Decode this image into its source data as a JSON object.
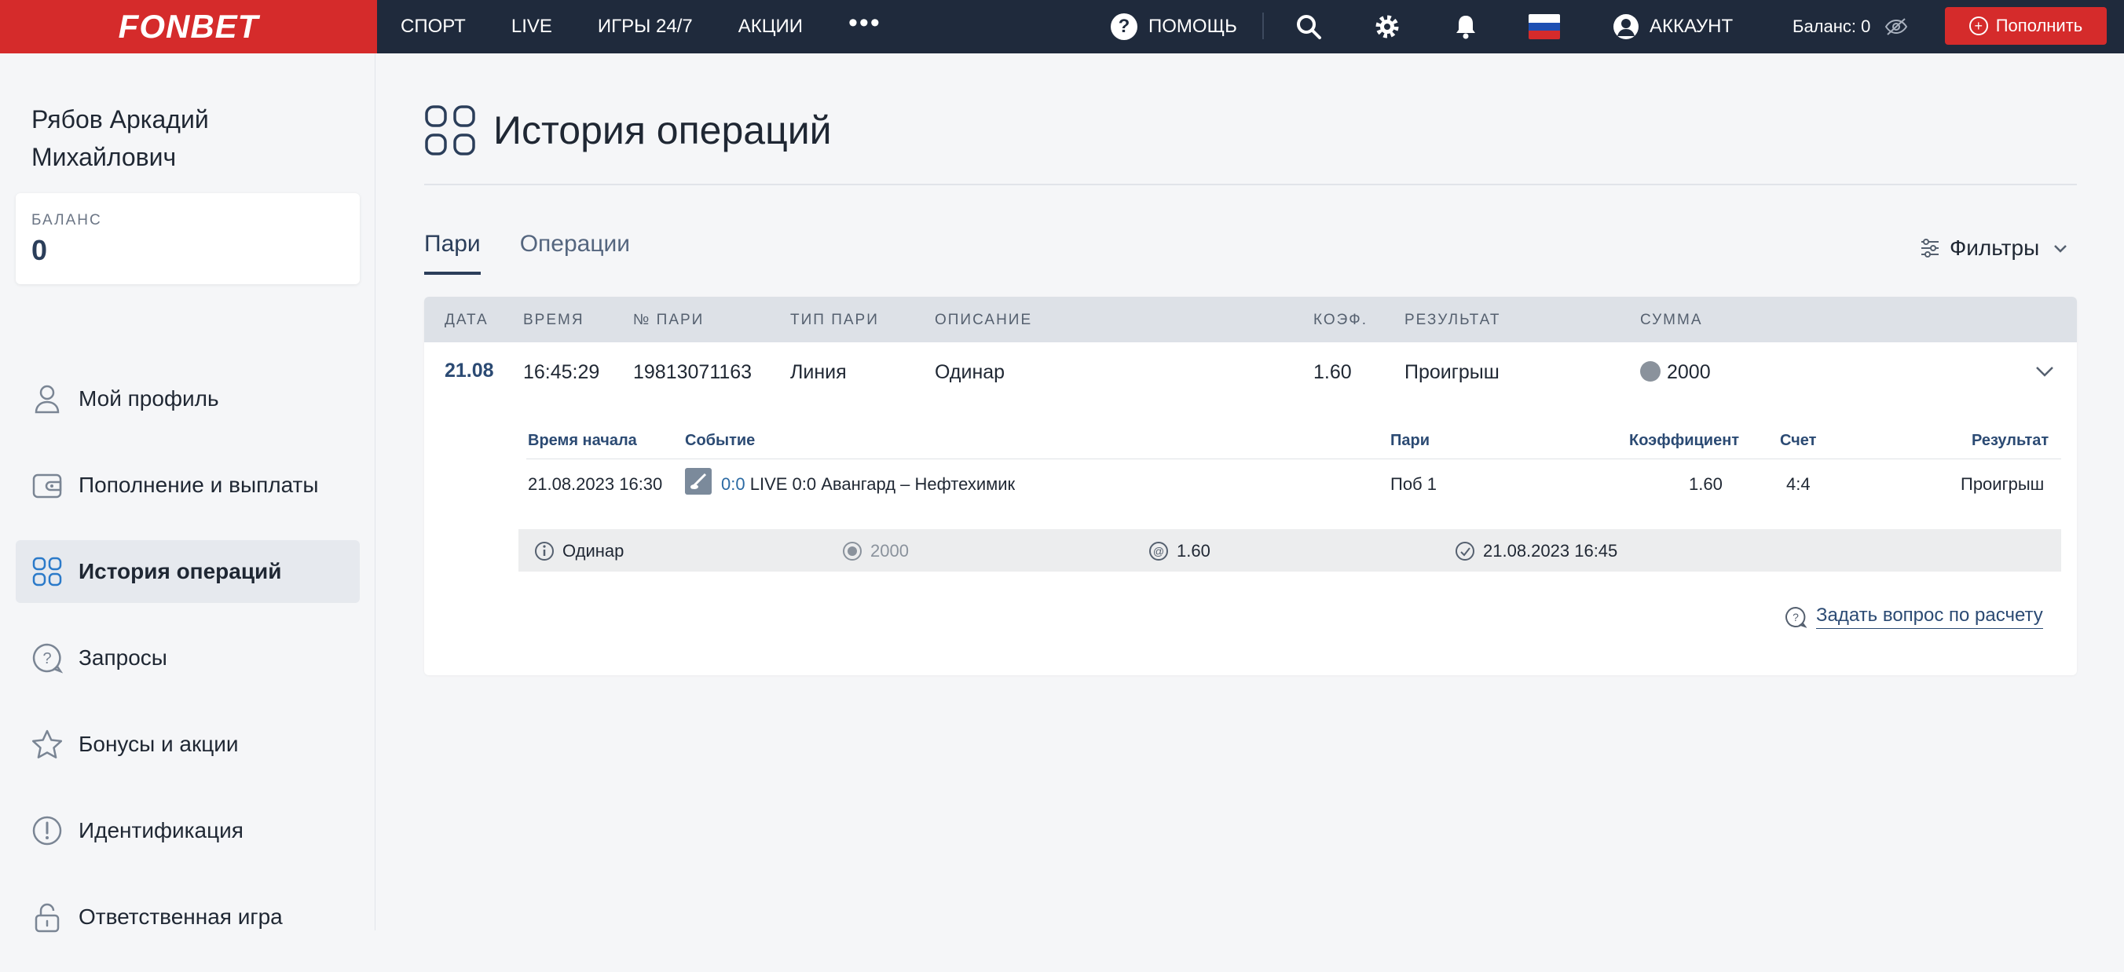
{
  "brand": {
    "logo": "FONBET",
    "accent": "#d52b2b",
    "nav_bg": "#1f2a3c"
  },
  "topbar": {
    "nav": [
      "СПОРТ",
      "LIVE",
      "ИГРЫ 24/7",
      "АКЦИИ"
    ],
    "more_icon": "more-dots-icon",
    "help": "ПОМОЩЬ",
    "account": "АККАУНТ",
    "balance": "Баланс: 0",
    "topup": "Пополнить",
    "icons": [
      "search-icon",
      "gear-icon",
      "bell-icon",
      "flag-russia-icon",
      "user-icon",
      "eye-hidden-icon"
    ]
  },
  "sidebar": {
    "user_name": "Рябов Аркадий Михайлович",
    "balance_label": "БАЛАНС",
    "balance_value": "0",
    "menu": [
      {
        "label": "Мой профиль",
        "icon": "user-icon"
      },
      {
        "label": "Пополнение и выплаты",
        "icon": "wallet-icon"
      },
      {
        "label": "История операций",
        "icon": "grid-icon",
        "active": true
      },
      {
        "label": "Запросы",
        "icon": "question-icon"
      },
      {
        "label": "Бонусы и акции",
        "icon": "star-icon"
      },
      {
        "label": "Идентификация",
        "icon": "alert-icon"
      },
      {
        "label": "Ответственная игра",
        "icon": "lock-icon"
      }
    ]
  },
  "main": {
    "title": "История операций",
    "tabs": [
      "Пари",
      "Операции"
    ],
    "active_tab": 0,
    "filters": "Фильтры",
    "table": {
      "headers": [
        "ДАТА",
        "ВРЕМЯ",
        "№ ПАРИ",
        "ТИП ПАРИ",
        "ОПИСАНИЕ",
        "КОЭФ.",
        "РЕЗУЛЬТАТ",
        "СУММА"
      ],
      "row": {
        "date": "21.08",
        "time": "16:45:29",
        "bet_no": "19813071163",
        "type": "Линия",
        "description": "Одинар",
        "coef": "1.60",
        "result": "Проигрыш",
        "amount": "2000"
      },
      "detail": {
        "headers": [
          "Время начала",
          "Событие",
          "Пари",
          "Коэффициент",
          "Счет",
          "Результат"
        ],
        "row": {
          "start": "21.08.2023 16:30",
          "live_score": "0:0",
          "event": "LIVE 0:0 Авангард – Нефтехимик",
          "bet": "Поб 1",
          "coef": "1.60",
          "score": "4:4",
          "result": "Проигрыш"
        }
      },
      "summary": {
        "type": "Одинар",
        "amount": "2000",
        "coef": "1.60",
        "datetime": "21.08.2023 16:45"
      },
      "ask_link": "Задать вопрос по расчету"
    }
  }
}
